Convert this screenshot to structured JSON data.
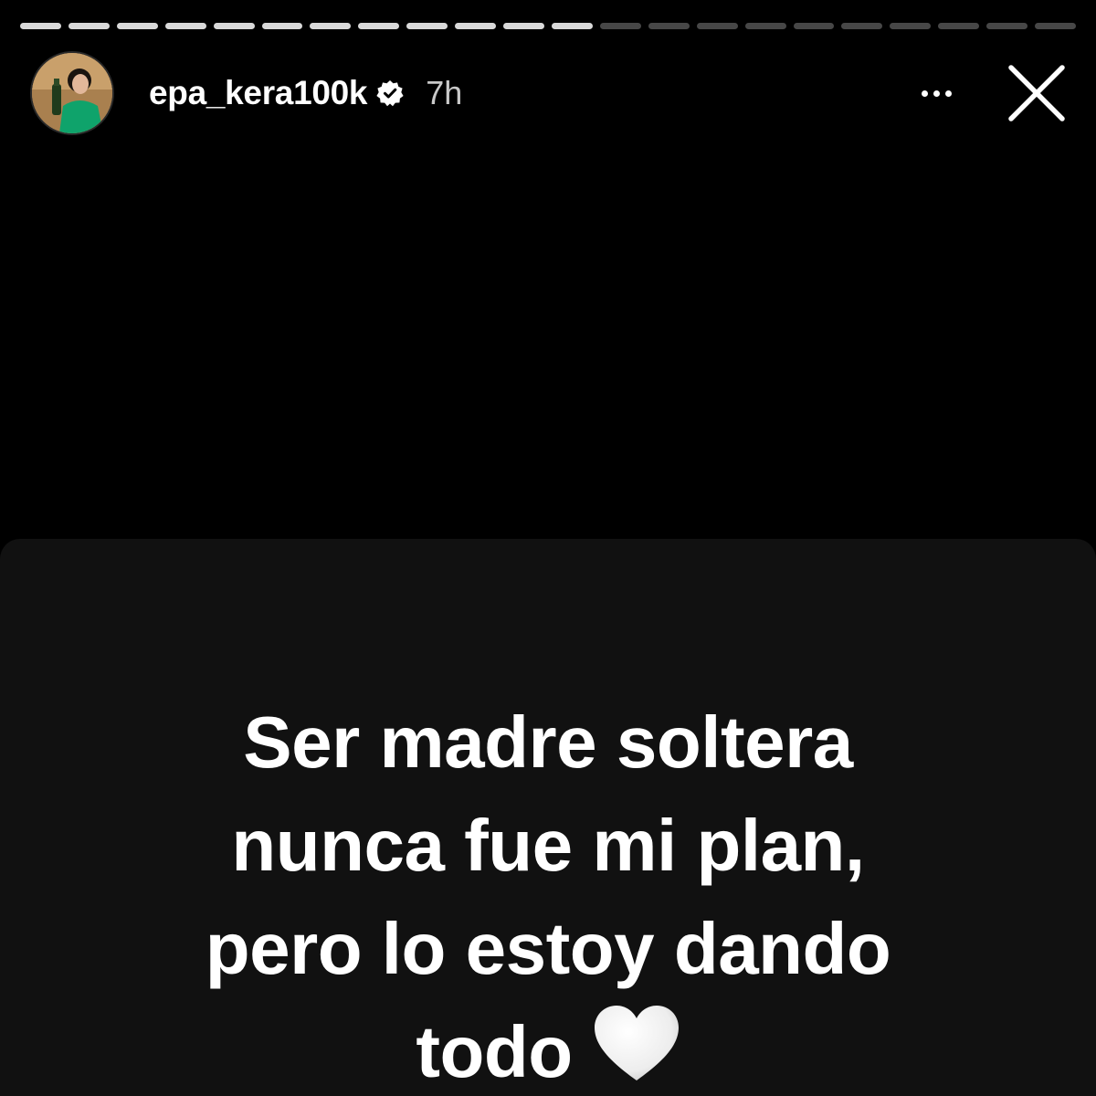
{
  "story": {
    "username": "epa_kera100k",
    "timestamp": "7h",
    "verified": true,
    "progress": {
      "completed": 12,
      "total": 22
    },
    "caption_lines": [
      "Ser madre soltera",
      "nunca fue mi plan,",
      "pero lo estoy dando",
      "todo"
    ],
    "caption_emoji": "white-heart-emoji"
  },
  "icons": {
    "verified": "verified-badge-icon",
    "more": "more-options-icon",
    "close": "close-icon"
  },
  "colors": {
    "background": "#000000",
    "card": "#111111",
    "text": "#ffffff",
    "timestamp": "#c9c9c9",
    "progress_filled": "#d9d9d9",
    "progress_empty": "#4a4a4a"
  }
}
